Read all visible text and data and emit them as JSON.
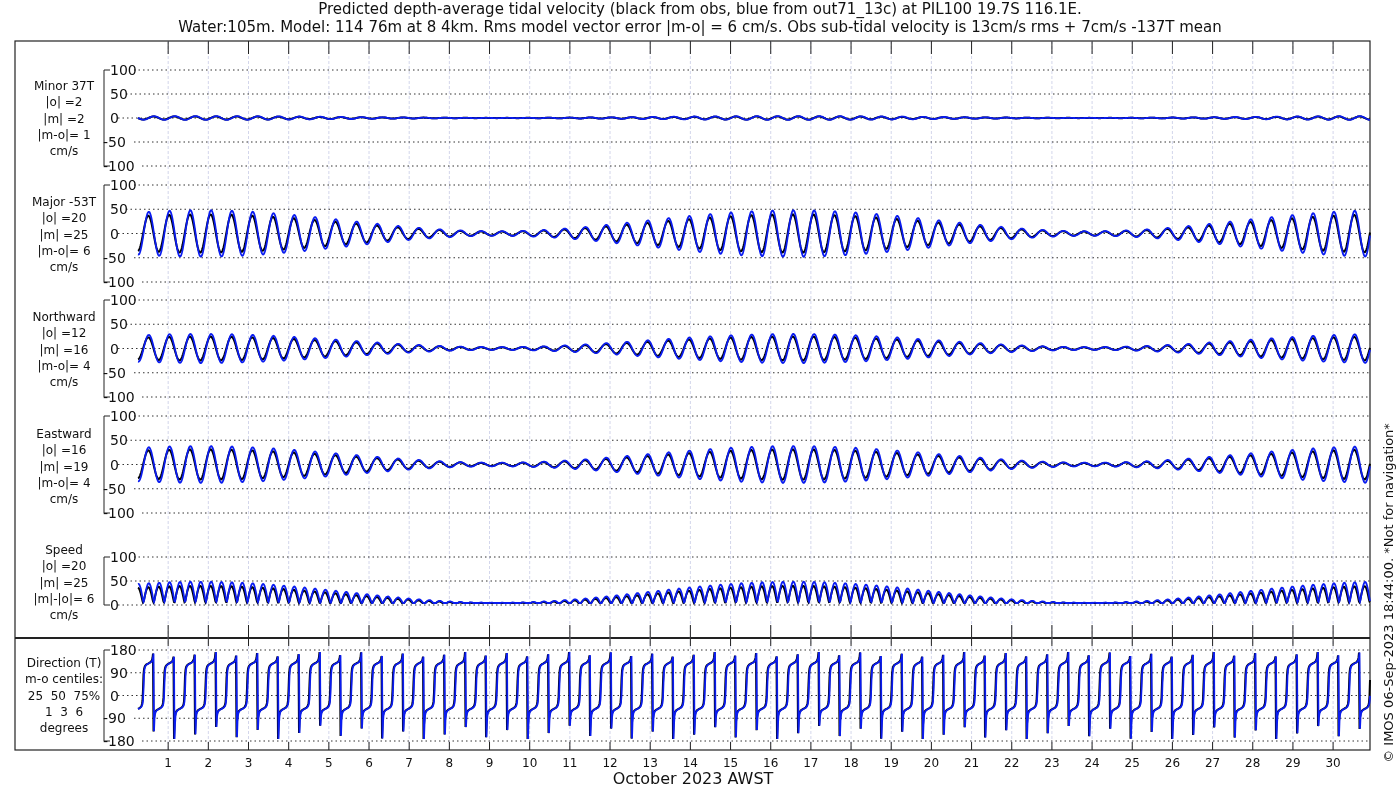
{
  "title": [
    "Predicted depth-average tidal velocity (black from obs, blue from out71_13c) at PIL100 19.7S 116.1E.",
    "Water:105m. Model: 114 76m at 8 4km. Rms model vector error |m-o| = 6 cm/s. Obs sub-tidal velocity is 13cm/s rms + 7cm/s -137T mean"
  ],
  "panels": [
    {
      "kind": "minor",
      "label_lines": [
        "Minor 37T",
        "|o| =2",
        "|m| =2",
        "|m-o|= 1",
        "cm/s"
      ],
      "yticks": [
        "100",
        "50",
        "0",
        "-50",
        "-100"
      ]
    },
    {
      "kind": "major",
      "label_lines": [
        "Major -53T",
        "|o| =20",
        "|m| =25",
        "|m-o|= 6",
        "cm/s"
      ],
      "yticks": [
        "100",
        "50",
        "0",
        "-50",
        "-100"
      ]
    },
    {
      "kind": "northward",
      "label_lines": [
        "Northward",
        "|o| =12",
        "|m| =16",
        "|m-o|= 4",
        "cm/s"
      ],
      "yticks": [
        "100",
        "50",
        "0",
        "-50",
        "-100"
      ]
    },
    {
      "kind": "eastward",
      "label_lines": [
        "Eastward",
        "|o| =16",
        "|m| =19",
        "|m-o|= 4",
        "cm/s"
      ],
      "yticks": [
        "100",
        "50",
        "0",
        "-50",
        "-100"
      ]
    },
    {
      "kind": "speed",
      "label_lines": [
        "Speed",
        "|o| =20",
        "|m| =25",
        "|m|-|o|= 6",
        "cm/s"
      ],
      "yticks": [
        "100",
        "50",
        "0"
      ]
    },
    {
      "kind": "direction",
      "label_lines": [
        "Direction (T)",
        "m-o centiles:",
        "25  50  75%",
        "1  3  6",
        "degrees"
      ],
      "yticks": [
        "180",
        "90",
        "0",
        "-90",
        "-180"
      ]
    }
  ],
  "x_axis": {
    "day_labels": [
      "1",
      "2",
      "3",
      "4",
      "5",
      "6",
      "7",
      "8",
      "9",
      "10",
      "11",
      "12",
      "13",
      "14",
      "15",
      "16",
      "17",
      "18",
      "19",
      "20",
      "21",
      "22",
      "23",
      "24",
      "25",
      "26",
      "27",
      "28",
      "29",
      "30"
    ],
    "label": "October 2023 AWST"
  },
  "credit": "© IMOS 06-Sep-2023 18:44:00. *Not for navigation*"
}
